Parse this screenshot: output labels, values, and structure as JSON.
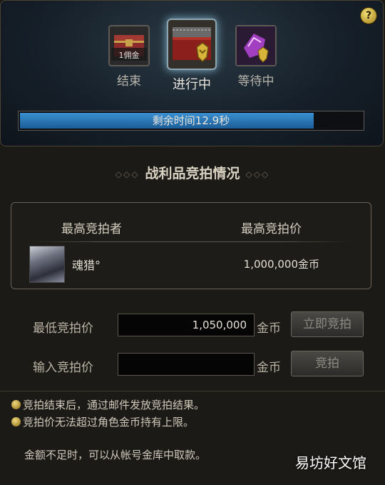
{
  "help": {
    "icon": "question-mark-icon",
    "label": "?"
  },
  "stages": [
    {
      "label": "结束",
      "icon": "treasure-chest-icon",
      "icon_text": "1佣金"
    },
    {
      "label": "进行中",
      "icon": "armor-chest-icon"
    },
    {
      "label": "等待中",
      "icon": "purple-gem-icon"
    }
  ],
  "timer": {
    "text": "剩余时间12.9秒",
    "fraction": 0.86
  },
  "section": {
    "title": "战利品竞拍情况",
    "ornament_left": "◇◇◇",
    "ornament_right": "◇◇◇"
  },
  "bid_table": {
    "col_bidder": "最高竞拍者",
    "col_price": "最高竞拍价",
    "bidder_name": "魂猎°",
    "bid_amount": "1,000,000金币"
  },
  "min_bid": {
    "label": "最低竞拍价",
    "value": "1,050,000",
    "unit": "金币",
    "button": "立即竞拍"
  },
  "input_bid": {
    "label": "输入竞拍价",
    "value": "",
    "unit": "金币",
    "button": "竞拍"
  },
  "notes": [
    "竞拍结束后，通过邮件发放竞拍结果。",
    "竞拍价无法超过角色金币持有上限。",
    "金额不足时，可以从帐号金库中取款。"
  ],
  "watermark": "易坊好文馆",
  "colors": {
    "progress": "#2a78bd",
    "gold": "#c9a43a"
  }
}
